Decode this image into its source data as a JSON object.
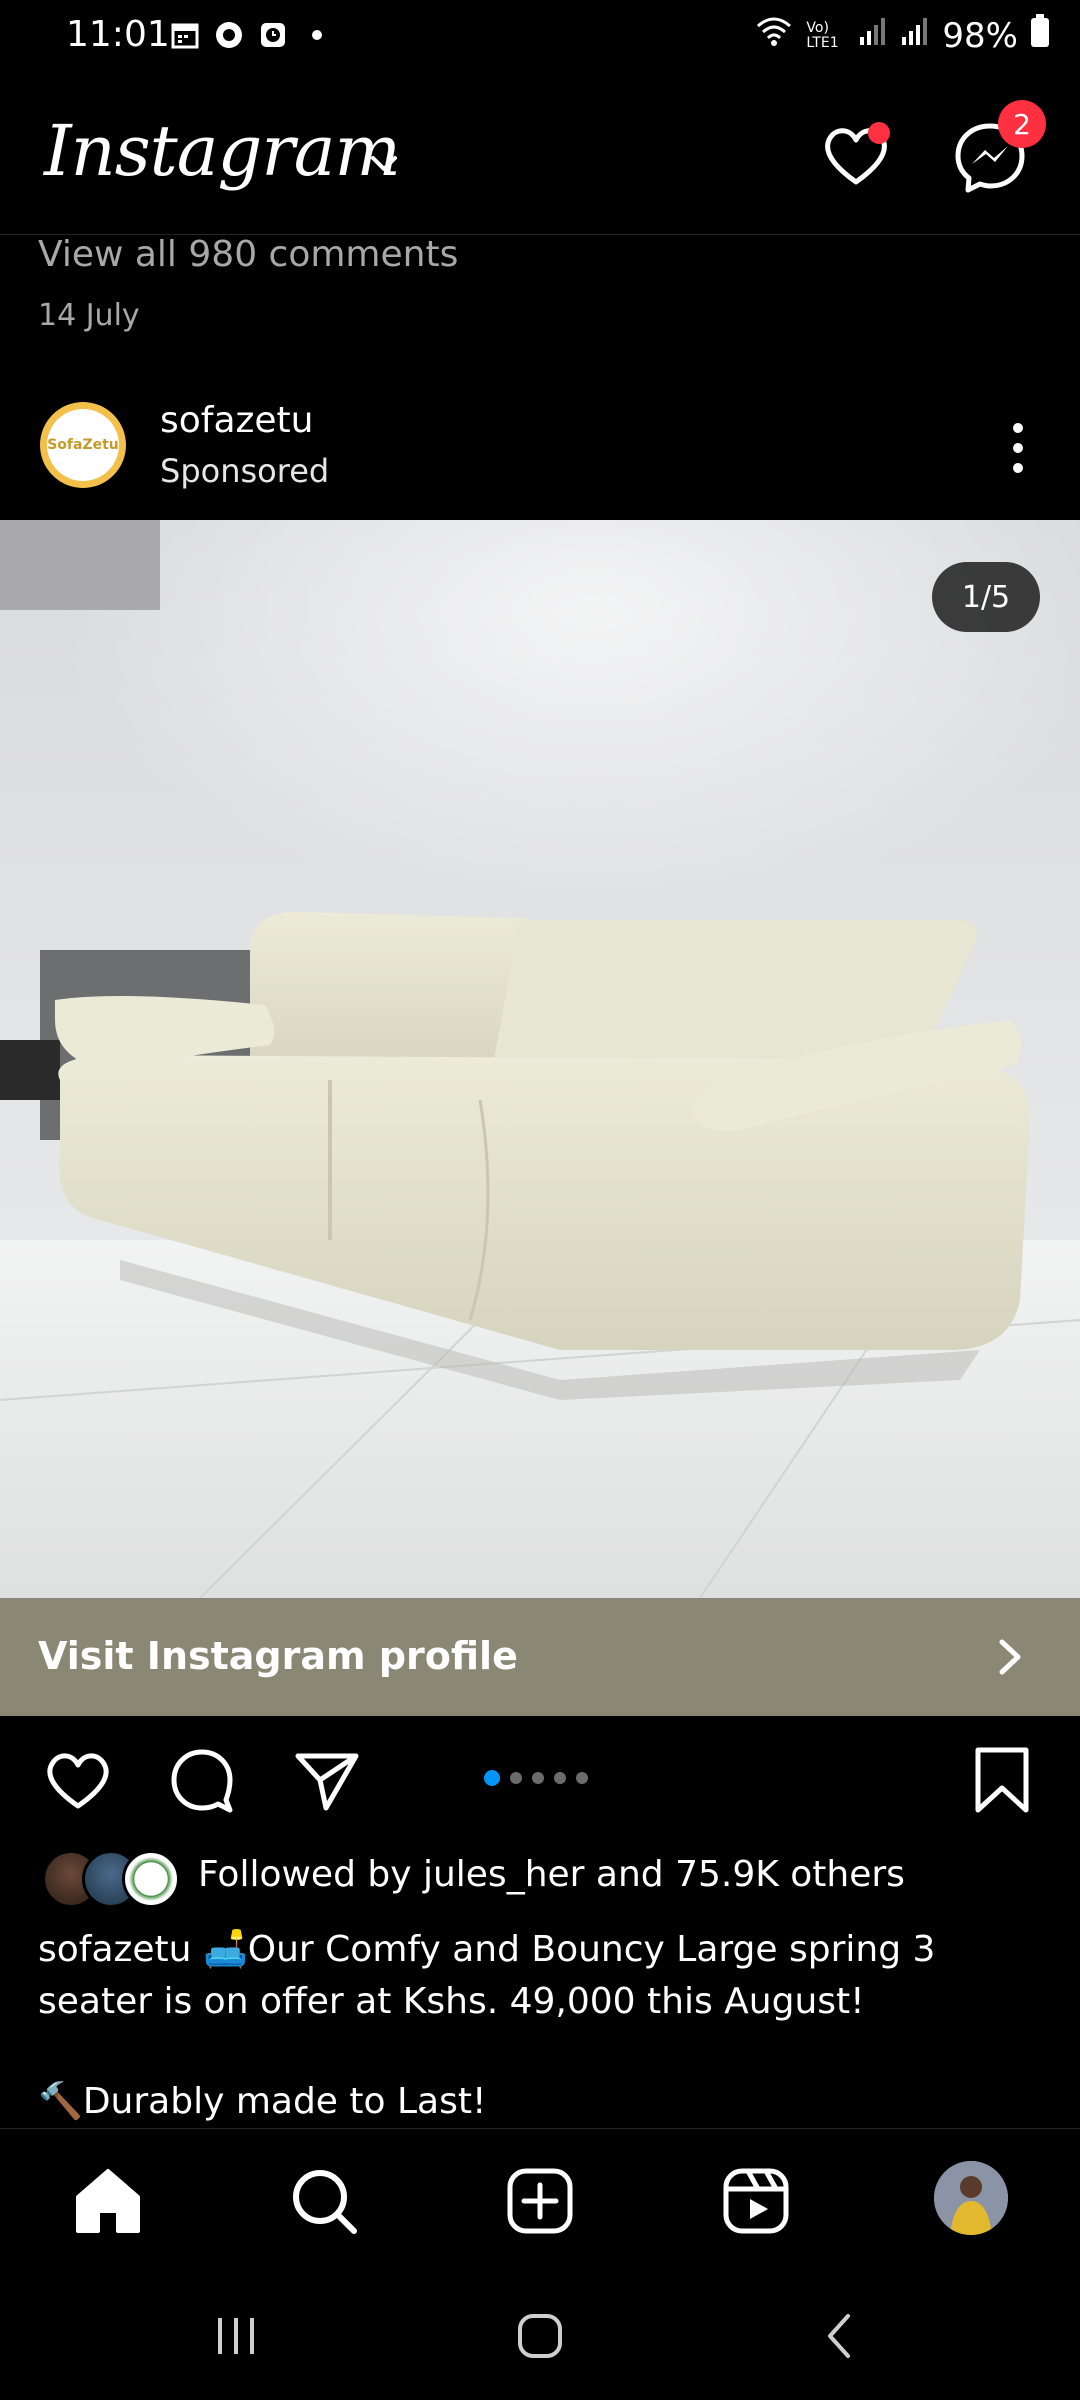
{
  "status_bar": {
    "time": "11:01",
    "battery": "98%",
    "network_label": "Vo) LTE1"
  },
  "header": {
    "logo": "Instagram",
    "notification_badge": "2"
  },
  "previous_post": {
    "comments_link": "View all 980 comments",
    "date": "14 July"
  },
  "post": {
    "username": "sofazetu",
    "label": "Sponsored",
    "avatar_text": "SofaZetu",
    "image_counter": "1/5",
    "visit_profile_label": "Visit Instagram profile",
    "carousel_total": 5,
    "carousel_active": 1,
    "followed_by": "Followed by jules_her and 75.9K others",
    "caption_username": "sofazetu",
    "caption_text": "🛋️Our Comfy and Bouncy Large spring 3 seater is on offer at Kshs. 49,000 this August!",
    "caption_line2": "🔨Durably made to Last!"
  },
  "colors": {
    "accent_blue": "#0095f6",
    "badge_red": "#ff3040",
    "visit_bar": "#8a8775"
  },
  "icons": {
    "header": [
      "heart-icon",
      "messenger-icon",
      "chevron-down-icon"
    ],
    "actions": [
      "like-icon",
      "comment-icon",
      "share-icon",
      "bookmark-icon"
    ],
    "nav": [
      "home-icon",
      "search-icon",
      "create-icon",
      "reels-icon",
      "profile-avatar"
    ]
  }
}
